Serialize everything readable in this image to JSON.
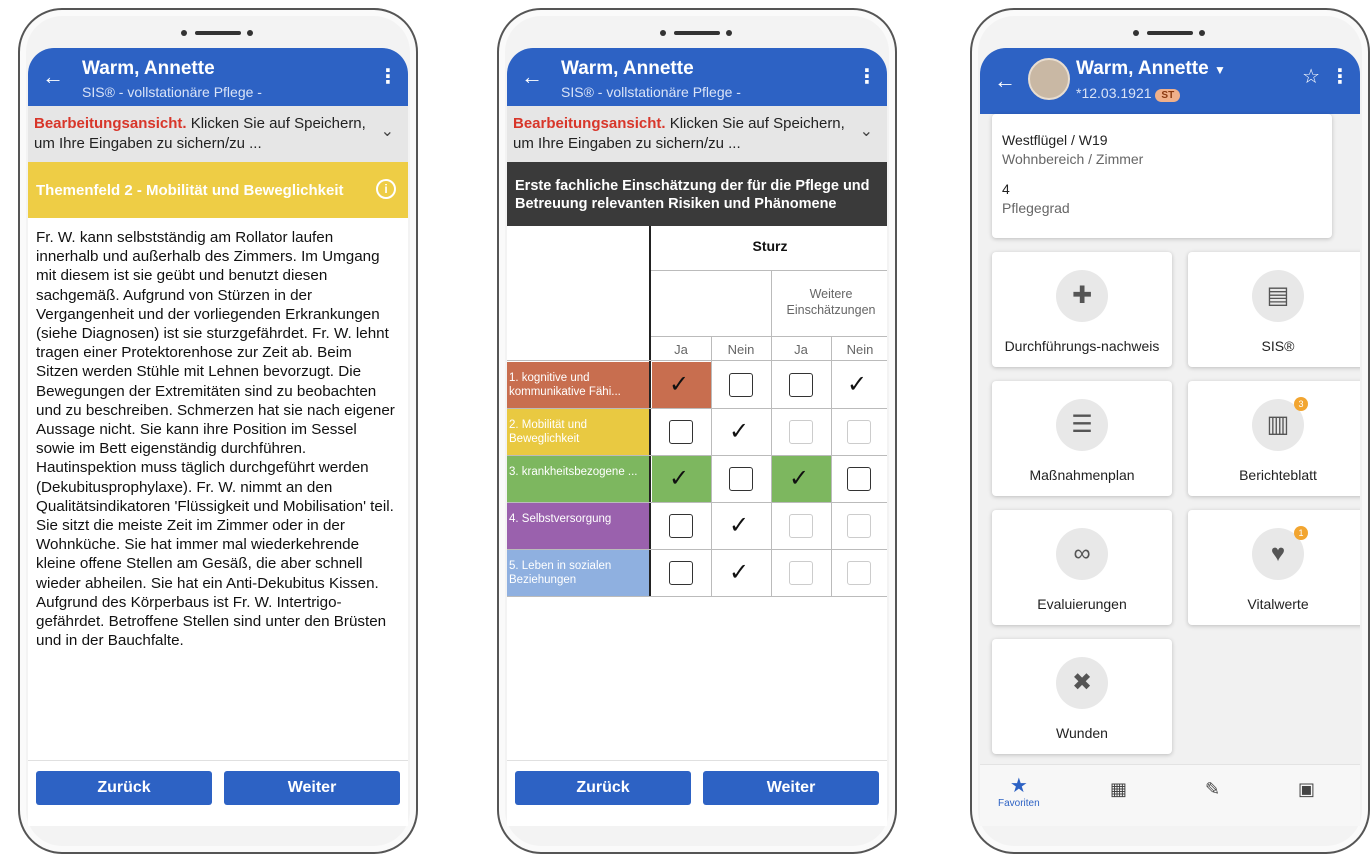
{
  "patient": {
    "name": "Warm, Annette",
    "module": "SIS® - vollstationäre Pflege -"
  },
  "editbar": {
    "highlight": "Bearbeitungsansicht.",
    "text": "Klicken Sie auf Speichern, um Ihre Eingaben zu sichern/zu ..."
  },
  "buttons": {
    "back": "Zurück",
    "next": "Weiter"
  },
  "screen1": {
    "theme_title": "Themenfeld 2 - Mobilität und Beweglichkeit",
    "body": "Fr. W. kann selbstständig am Rollator laufen innerhalb und außerhalb des Zimmers. Im Umgang mit diesem ist sie geübt und benutzt diesen sachgemäß. Aufgrund von Stürzen in der Vergangenheit und der vorliegenden Erkrankungen (siehe Diagnosen) ist sie sturzgefährdet. Fr. W. lehnt tragen einer Protektorenhose zur Zeit ab. Beim Sitzen werden Stühle mit Lehnen bevorzugt. Die Bewegungen der Extremitäten sind zu beobachten und zu beschreiben. Schmerzen hat sie  nach eigener Aussage nicht. Sie kann ihre Position im Sessel sowie im Bett eigenständig durchführen. Hautinspektion muss täglich durchgeführt werden (Dekubitusprophylaxe). Fr. W. nimmt an den Qualitätsindikatoren 'Flüssigkeit und Mobilisation' teil. Sie sitzt die meiste Zeit im Zimmer oder in der Wohnküche. Sie hat immer mal wiederkehrende kleine offene Stellen am Gesäß, die aber schnell wieder abheilen. Sie hat ein Anti-Dekubitus Kissen. Aufgrund des Körperbaus ist Fr. W. Intertrigo-gefährdet. Betroffene Stellen sind unter den Brüsten und in der Bauchfalte."
  },
  "screen2": {
    "header": "Erste fachliche Einschätzung der für die Pflege und Betreuung relevanten Risiken und Phänomene",
    "risk": "Sturz",
    "further": "Weitere Einschätzungen",
    "cols": [
      "Ja",
      "Nein",
      "Ja",
      "Nein"
    ],
    "rows": [
      {
        "label": "1. kognitive und kommunikative Fähi...",
        "color": "#c86e4f",
        "checks": [
          true,
          false,
          false,
          true
        ]
      },
      {
        "label": "2. Mobilität und Beweglichkeit",
        "color": "#e9c941",
        "checks": [
          false,
          true,
          null,
          null
        ]
      },
      {
        "label": "3. krankheitsbezogene ...",
        "color": "#7db75f",
        "checks": [
          true,
          false,
          true,
          false
        ]
      },
      {
        "label": "4. Selbstversorgung",
        "color": "#9a61ad",
        "checks": [
          false,
          true,
          null,
          null
        ]
      },
      {
        "label": "5. Leben in sozialen Beziehungen",
        "color": "#8fb0e0",
        "checks": [
          false,
          true,
          null,
          null
        ]
      }
    ]
  },
  "screen3": {
    "dob": "*12.03.1921",
    "badge": "ST",
    "location": "Westflügel / W19",
    "location_label": "Wohnbereich / Zimmer",
    "care_level": "4",
    "care_level_label": "Pflegegrad",
    "tiles": [
      {
        "label": "Durchführungs-nachweis",
        "icon": "plus-square-icon"
      },
      {
        "label": "SIS®",
        "icon": "sis-document-icon"
      },
      {
        "label": "Maßnahmenplan",
        "icon": "clipboard-icon"
      },
      {
        "label": "Berichteblatt",
        "icon": "notebook-icon",
        "badge": "3"
      },
      {
        "label": "Evaluierungen",
        "icon": "glasses-icon"
      },
      {
        "label": "Vitalwerte",
        "icon": "heartbeat-icon",
        "badge": "1"
      },
      {
        "label": "Wunden",
        "icon": "bandage-icon"
      }
    ],
    "nav": {
      "favorites": "Favoriten"
    }
  },
  "colors": {
    "primary": "#2d62c4",
    "accent_red": "#d8362a",
    "theme_yellow": "#eecd45"
  }
}
